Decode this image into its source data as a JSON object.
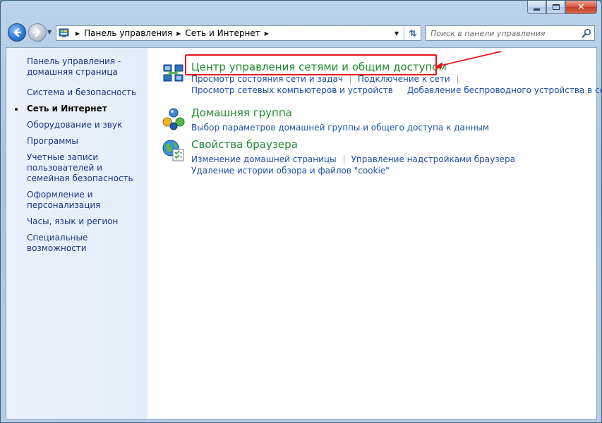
{
  "window": {
    "title": "",
    "controls": {
      "minimize": "minimize",
      "maximize": "maximize",
      "close": "close"
    }
  },
  "navigation": {
    "breadcrumbs": [
      "Панель управления",
      "Сеть и Интернет"
    ],
    "search_placeholder": "Поиск в панели управления"
  },
  "sidebar": {
    "items": [
      {
        "label": "Панель управления - домашняя страница",
        "current": false
      },
      {
        "label": "Система и безопасность",
        "current": false
      },
      {
        "label": "Сеть и Интернет",
        "current": true
      },
      {
        "label": "Оборудование и звук",
        "current": false
      },
      {
        "label": "Программы",
        "current": false
      },
      {
        "label": "Учетные записи пользователей и семейная безопасность",
        "current": false
      },
      {
        "label": "Оформление и персонализация",
        "current": false
      },
      {
        "label": "Часы, язык и регион",
        "current": false
      },
      {
        "label": "Специальные возможности",
        "current": false
      }
    ]
  },
  "categories": [
    {
      "title": "Центр управления сетями и общим доступом",
      "icon": "network-center-icon",
      "links": [
        [
          "Просмотр состояния сети и задач",
          "Подключение к сети"
        ],
        [
          "Просмотр сетевых компьютеров и устройств",
          "Добавление беспроводного устройства в сеть"
        ]
      ]
    },
    {
      "title": "Домашняя группа",
      "icon": "homegroup-icon",
      "links": [
        [
          "Выбор параметров домашней группы и общего доступа к данным"
        ]
      ]
    },
    {
      "title": "Свойства браузера",
      "icon": "internet-options-icon",
      "links": [
        [
          "Изменение домашней страницы",
          "Управление надстройками браузера"
        ],
        [
          "Удаление истории обзора и файлов \"cookie\""
        ]
      ]
    }
  ],
  "colors": {
    "category_title": "#1e8a2a",
    "task_link": "#1f4ea7",
    "sidebar_link": "#1e3287",
    "annotation": "#e8141c"
  }
}
